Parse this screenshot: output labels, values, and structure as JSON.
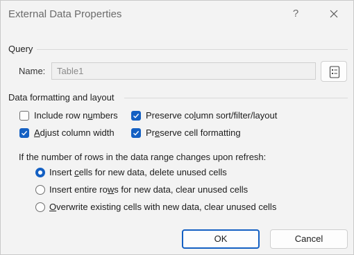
{
  "window": {
    "title": "External Data Properties",
    "help": "?"
  },
  "query": {
    "section_label": "Query",
    "name_label": "Name:",
    "name_value": "Table1"
  },
  "formatting": {
    "section_label": "Data formatting and layout",
    "checkboxes": [
      {
        "pre": "Include row n",
        "key": "u",
        "post": "mbers",
        "checked": false
      },
      {
        "pre": "Preserve co",
        "key": "l",
        "post": "umn sort/filter/layout",
        "checked": true
      },
      {
        "pre": "",
        "key": "A",
        "post": "djust column width",
        "checked": true
      },
      {
        "pre": "Pr",
        "key": "e",
        "post": "serve cell formatting",
        "checked": true
      }
    ]
  },
  "refresh": {
    "question": "If the number of rows in the data range changes upon refresh:",
    "options": [
      {
        "pre": "Insert ",
        "key": "c",
        "post": "ells for new data, delete unused cells",
        "selected": true
      },
      {
        "pre": "Insert entire ro",
        "key": "w",
        "post": "s for new data, clear unused cells",
        "selected": false
      },
      {
        "pre": "",
        "key": "O",
        "post": "verwrite existing cells with new data, clear unused cells",
        "selected": false
      }
    ]
  },
  "buttons": {
    "ok": "OK",
    "cancel": "Cancel"
  },
  "colors": {
    "accent": "#1460c3",
    "background": "#f3f3f3"
  },
  "icons": {
    "close": "close-icon",
    "properties": "query-properties-icon",
    "check": "checkmark-icon"
  }
}
